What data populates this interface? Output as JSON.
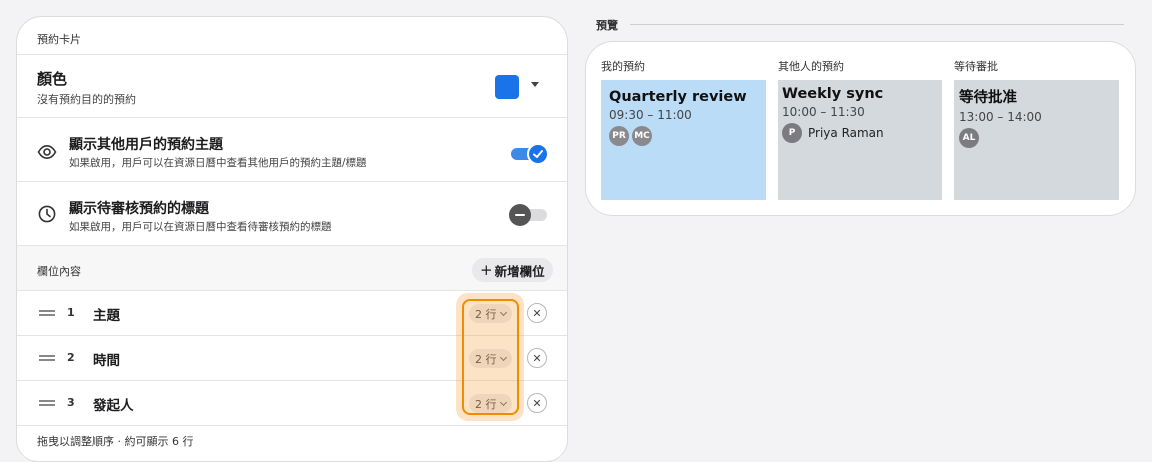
{
  "settings": {
    "header": "預約卡片",
    "color": {
      "title": "顏色",
      "subtitle": "沒有預約目的的預約",
      "swatch": "#1a73e8"
    },
    "show_others": {
      "title": "顯示其他用戶的預約主題",
      "subtitle": "如果啟用，用戶可以在資源日曆中查看其他用戶的預約主題/標題",
      "enabled": true,
      "icon": "eye-icon"
    },
    "show_pending": {
      "title": "顯示待審核預約的標題",
      "subtitle": "如果啟用，用戶可以在資源日曆中查看待審核預約的標題",
      "enabled": false,
      "icon": "clock-icon"
    },
    "fields": {
      "label": "欄位內容",
      "add_label": "新增欄位",
      "rows": [
        {
          "num": "1",
          "name": "主題",
          "lines": "2 行"
        },
        {
          "num": "2",
          "name": "時間",
          "lines": "2 行"
        },
        {
          "num": "3",
          "name": "發起人",
          "lines": "2 行"
        }
      ],
      "footer": "拖曳以調整順序 · 約可顯示 6 行"
    },
    "highlight_color": "#f08c00"
  },
  "preview": {
    "label": "預覽",
    "columns": [
      {
        "label": "我的預約",
        "title": "Quarterly review",
        "time": "09:30 – 11:00",
        "bg": "#bbdcf7",
        "avatars": [
          {
            "initials": "PR",
            "color": "#8a8a8e"
          },
          {
            "initials": "MC",
            "color": "#8a8a8e"
          }
        ],
        "person": ""
      },
      {
        "label": "其他人的預約",
        "title": "Weekly sync",
        "time": "10:00 – 11:30",
        "bg": "#d4d9de",
        "avatars": [
          {
            "initials": "P",
            "color": "#7b7b80"
          }
        ],
        "person": "Priya Raman"
      },
      {
        "label": "等待審批",
        "title": "等待批准",
        "time": "13:00 – 14:00",
        "bg": "#d4d9de",
        "avatars": [
          {
            "initials": "AL",
            "color": "#7b7b80"
          }
        ],
        "person": ""
      }
    ]
  }
}
